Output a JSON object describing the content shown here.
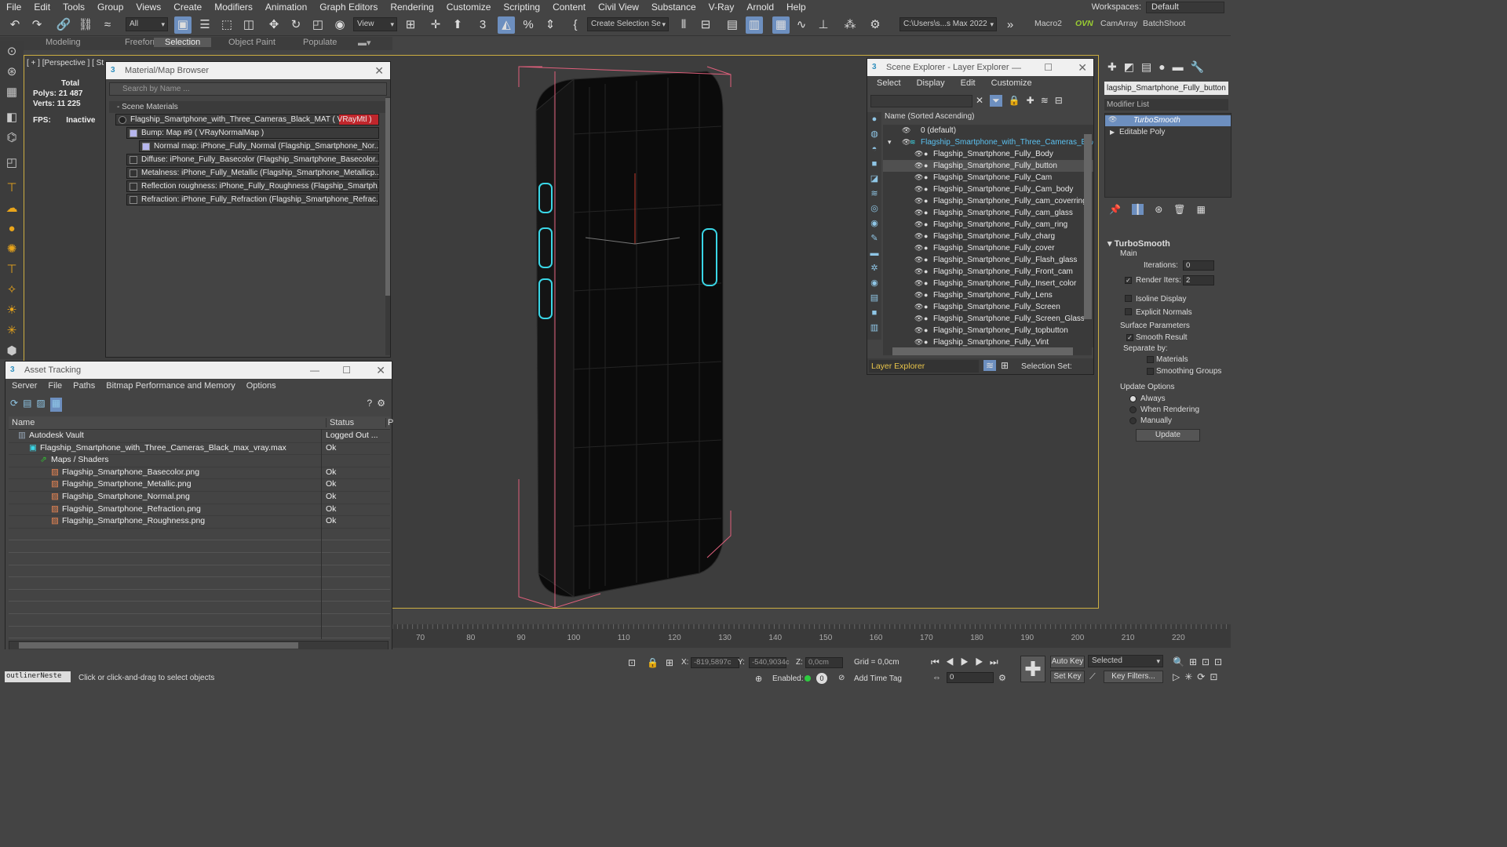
{
  "menu": [
    "File",
    "Edit",
    "Tools",
    "Group",
    "Views",
    "Create",
    "Modifiers",
    "Animation",
    "Graph Editors",
    "Rendering",
    "Customize",
    "Scripting",
    "Content",
    "Civil View",
    "Substance",
    "V-Ray",
    "Arnold",
    "Help"
  ],
  "workspace": {
    "label": "Workspaces:",
    "value": "Default"
  },
  "toolbar": {
    "filter_all": "All",
    "ref_coord": "View",
    "selection_set": "Create Selection Se",
    "project_path": "C:\\Users\\s...s Max 2022",
    "macro2": "Macro2",
    "ovn": "OVN",
    "camarray": "CamArray",
    "batchshoot": "BatchShoot"
  },
  "ribbon_tabs": [
    "Modeling",
    "Freeform",
    "Selection",
    "Object Paint",
    "Populate"
  ],
  "ribbon_active": 2,
  "viewport": {
    "label": "[ + ] [Perspective ] [ St",
    "stats": {
      "total_label": "Total",
      "polys_label": "Polys:",
      "polys": "21 487",
      "verts_label": "Verts:",
      "verts": "11 225",
      "fps_label": "FPS:",
      "fps": "Inactive"
    }
  },
  "material_browser": {
    "title": "Material/Map Browser",
    "search_placeholder": "Search by Name ...",
    "section": "- Scene Materials",
    "items": [
      "Flagship_Smartphone_with_Three_Cameras_Black_MAT  ( VRayMtl )",
      "Bump: Map #9  ( VRayNormalMap )",
      "Normal map: iPhone_Fully_Normal (Flagship_Smartphone_Nor...",
      "Diffuse: iPhone_Fully_Basecolor (Flagship_Smartphone_Basecolor....",
      "Metalness: iPhone_Fully_Metallic (Flagship_Smartphone_Metallicp...",
      "Reflection roughness: iPhone_Fully_Roughness (Flagship_Smartph...",
      "Refraction: iPhone_Fully_Refraction (Flagship_Smartphone_Refrac..."
    ]
  },
  "asset_tracking": {
    "title": "Asset Tracking",
    "menu": [
      "Server",
      "File",
      "Paths",
      "Bitmap Performance and Memory",
      "Options"
    ],
    "columns": [
      "Name",
      "Status",
      "P"
    ],
    "rows": [
      {
        "name": "Autodesk Vault",
        "status": "Logged Out ...",
        "indent": 1
      },
      {
        "name": "Flagship_Smartphone_with_Three_Cameras_Black_max_vray.max",
        "status": "Ok",
        "indent": 2
      },
      {
        "name": "Maps / Shaders",
        "status": "",
        "indent": 3
      },
      {
        "name": "Flagship_Smartphone_Basecolor.png",
        "status": "Ok",
        "indent": 4
      },
      {
        "name": "Flagship_Smartphone_Metallic.png",
        "status": "Ok",
        "indent": 4
      },
      {
        "name": "Flagship_Smartphone_Normal.png",
        "status": "Ok",
        "indent": 4
      },
      {
        "name": "Flagship_Smartphone_Refraction.png",
        "status": "Ok",
        "indent": 4
      },
      {
        "name": "Flagship_Smartphone_Roughness.png",
        "status": "Ok",
        "indent": 4
      }
    ]
  },
  "scene_explorer": {
    "title": "Scene Explorer - Layer Explorer",
    "menu": [
      "Select",
      "Display",
      "Edit",
      "Customize"
    ],
    "header": "Name (Sorted Ascending)",
    "layers": [
      {
        "name": "0 (default)",
        "level": 0
      },
      {
        "name": "Flagship_Smartphone_with_Three_Cameras_Blac",
        "level": 1,
        "highlight": true
      },
      {
        "name": "Flagship_Smartphone_Fully_Body",
        "level": 2
      },
      {
        "name": "Flagship_Smartphone_Fully_button",
        "level": 2,
        "selected": true
      },
      {
        "name": "Flagship_Smartphone_Fully_Cam",
        "level": 2
      },
      {
        "name": "Flagship_Smartphone_Fully_Cam_body",
        "level": 2
      },
      {
        "name": "Flagship_Smartphone_Fully_cam_coverring",
        "level": 2
      },
      {
        "name": "Flagship_Smartphone_Fully_cam_glass",
        "level": 2
      },
      {
        "name": "Flagship_Smartphone_Fully_cam_ring",
        "level": 2
      },
      {
        "name": "Flagship_Smartphone_Fully_charg",
        "level": 2
      },
      {
        "name": "Flagship_Smartphone_Fully_cover",
        "level": 2
      },
      {
        "name": "Flagship_Smartphone_Fully_Flash_glass",
        "level": 2
      },
      {
        "name": "Flagship_Smartphone_Fully_Front_cam",
        "level": 2
      },
      {
        "name": "Flagship_Smartphone_Fully_Insert_color",
        "level": 2
      },
      {
        "name": "Flagship_Smartphone_Fully_Lens",
        "level": 2
      },
      {
        "name": "Flagship_Smartphone_Fully_Screen",
        "level": 2
      },
      {
        "name": "Flagship_Smartphone_Fully_Screen_Glass",
        "level": 2
      },
      {
        "name": "Flagship_Smartphone_Fully_topbutton",
        "level": 2
      },
      {
        "name": "Flagship_Smartphone_Fully_Vint",
        "level": 2
      }
    ],
    "footer_label": "Layer Explorer",
    "selection_set_label": "Selection Set:"
  },
  "command_panel": {
    "object_name": "lagship_Smartphone_Fully_button",
    "modifier_list": "Modifier List",
    "stack": [
      "TurboSmooth",
      "Editable Poly"
    ],
    "rollout_title": "TurboSmooth",
    "main_label": "Main",
    "iterations_label": "Iterations:",
    "iterations": "0",
    "render_iters_label": "Render Iters:",
    "render_iters": "2",
    "isoline": "Isoline Display",
    "explicit": "Explicit Normals",
    "surface_params": "Surface Parameters",
    "smooth_result": "Smooth Result",
    "separate_by": "Separate by:",
    "materials": "Materials",
    "smoothing_groups": "Smoothing Groups",
    "update_options": "Update Options",
    "always": "Always",
    "when_rendering": "When Rendering",
    "manually": "Manually",
    "update_btn": "Update"
  },
  "timeline": {
    "ticks": [
      "70",
      "80",
      "90",
      "100",
      "110",
      "120",
      "130",
      "140",
      "150",
      "160",
      "170",
      "180",
      "190",
      "200",
      "210",
      "220"
    ]
  },
  "status": {
    "script_box": "outlinerNeste",
    "prompt": "Click or click-and-drag to select objects",
    "x_label": "X:",
    "x": "-819,5897c",
    "y_label": "Y:",
    "y": "-540,9034c",
    "z_label": "Z:",
    "z": "0,0cm",
    "grid": "Grid = 0,0cm",
    "enabled": "Enabled:",
    "add_time_tag": "Add Time Tag",
    "frame": "0",
    "auto_key": "Auto Key",
    "set_key": "Set Key",
    "selected": "Selected",
    "key_filters": "Key Filters..."
  },
  "colors": {
    "accent": "#6d8fbf",
    "cyan": "#3ad6e6",
    "pink": "#e0607c",
    "viewport_border": "#ccae42",
    "highlight_text": "#5bc0ef"
  }
}
